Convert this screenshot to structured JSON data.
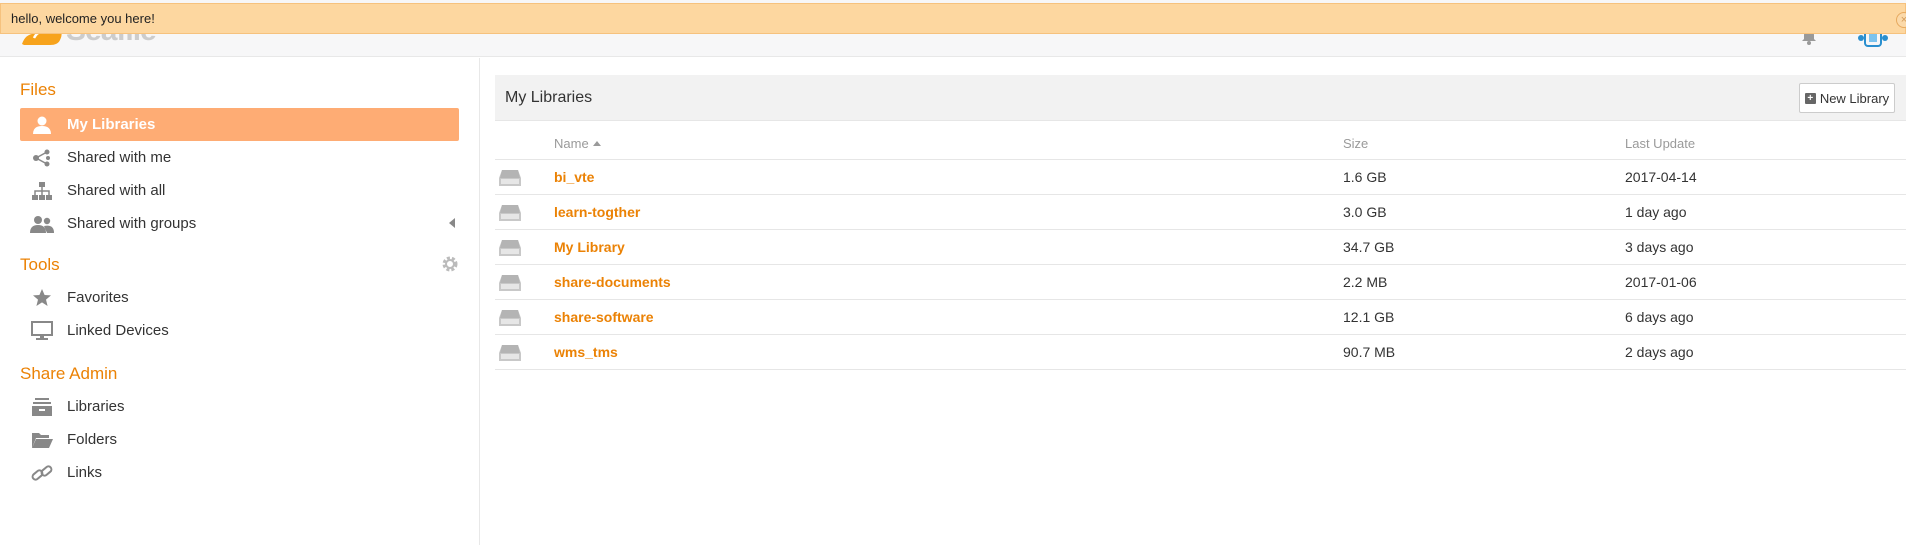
{
  "notice": {
    "text": "hello, welcome you here!",
    "close_icon": "×"
  },
  "header": {
    "logo_text": "Seafile",
    "bell_icon": "bell-icon",
    "avatar_icon": "avatar"
  },
  "sidebar": {
    "files_heading": "Files",
    "files_items": [
      {
        "label": "My Libraries",
        "icon": "user-icon",
        "active": true
      },
      {
        "label": "Shared with me",
        "icon": "share-icon"
      },
      {
        "label": "Shared with all",
        "icon": "org-tree-icon"
      },
      {
        "label": "Shared with groups",
        "icon": "group-icon"
      }
    ],
    "tools_heading": "Tools",
    "tools_items": [
      {
        "label": "Favorites",
        "icon": "star-icon"
      },
      {
        "label": "Linked Devices",
        "icon": "monitor-icon"
      }
    ],
    "share_admin_heading": "Share Admin",
    "share_admin_items": [
      {
        "label": "Libraries",
        "icon": "library-stack-icon"
      },
      {
        "label": "Folders",
        "icon": "folder-open-icon"
      },
      {
        "label": "Links",
        "icon": "link-icon"
      }
    ]
  },
  "main": {
    "title": "My Libraries",
    "new_library_label": "New Library",
    "columns": {
      "name": "Name",
      "size": "Size",
      "last_update": "Last Update"
    },
    "rows": [
      {
        "name": "bi_vte",
        "size": "1.6 GB",
        "last_update": "2017-04-14"
      },
      {
        "name": "learn-togther",
        "size": "3.0 GB",
        "last_update": "1 day ago"
      },
      {
        "name": "My Library",
        "size": "34.7 GB",
        "last_update": "3 days ago"
      },
      {
        "name": "share-documents",
        "size": "2.2 MB",
        "last_update": "2017-01-06"
      },
      {
        "name": "share-software",
        "size": "12.1 GB",
        "last_update": "6 days ago"
      },
      {
        "name": "wms_tms",
        "size": "90.7 MB",
        "last_update": "2 days ago"
      }
    ]
  },
  "colors": {
    "accent": "#eb8205",
    "active_bg": "#feac74",
    "notice_bg": "#fdd7a0"
  }
}
